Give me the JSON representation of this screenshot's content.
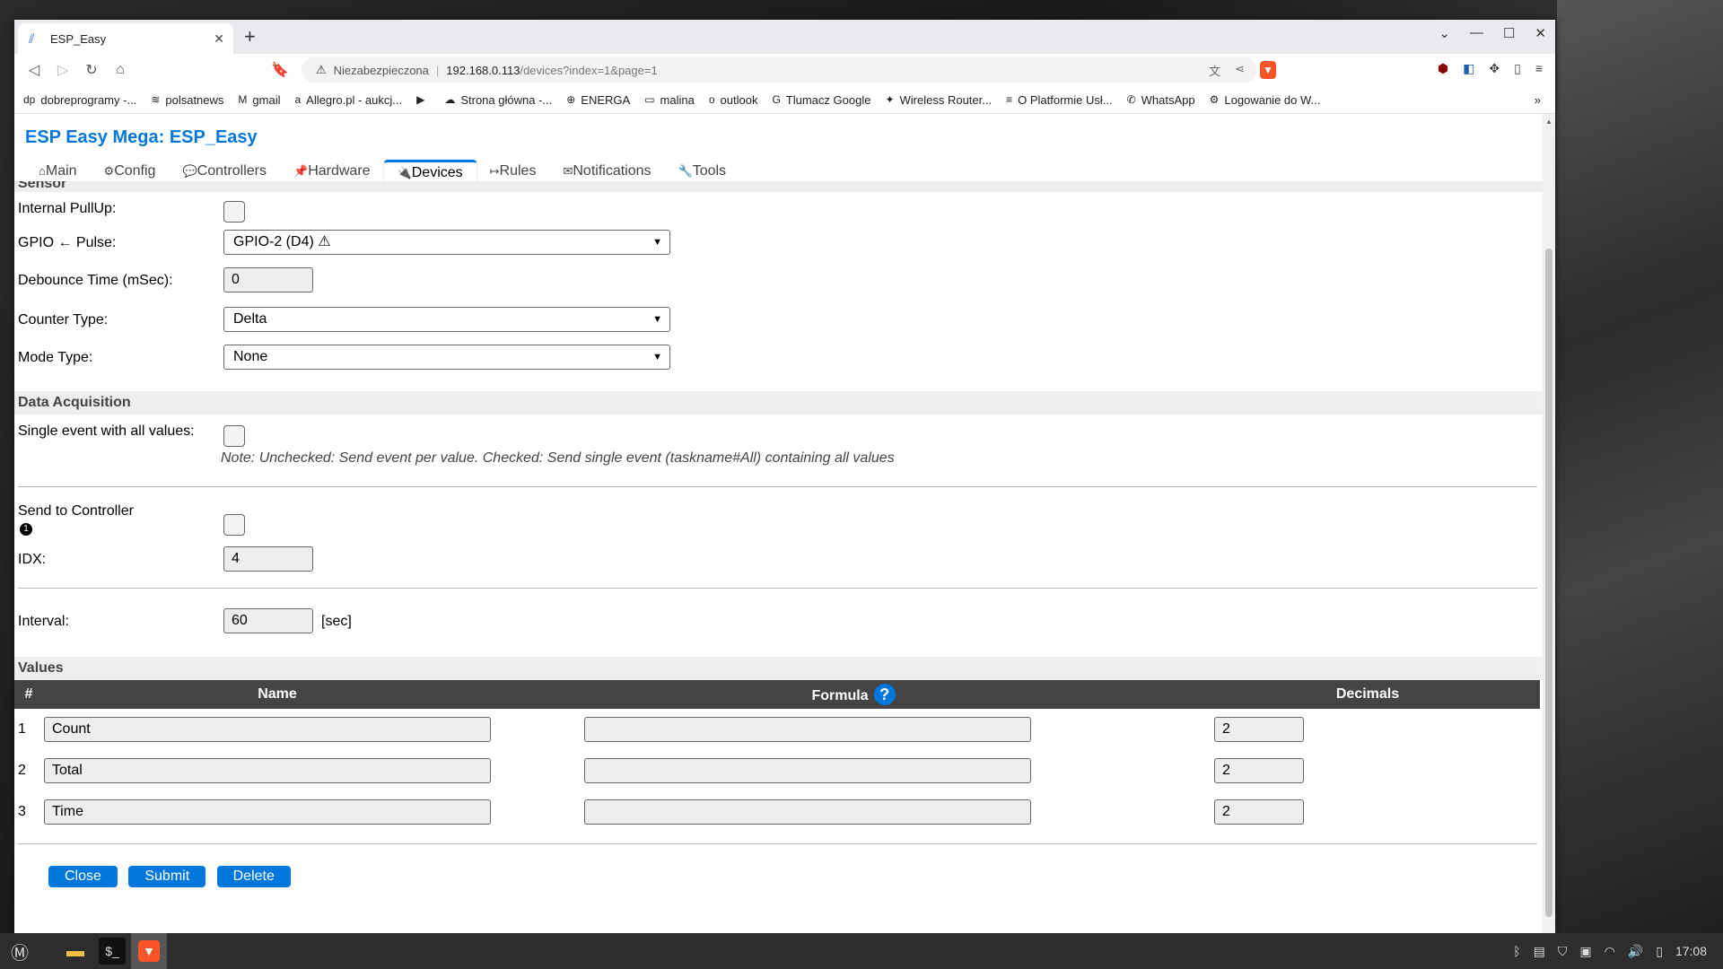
{
  "browser": {
    "tab_title": "ESP_Easy",
    "new_tab": "+",
    "url_warning": "Niezabezpieczona",
    "url_host": "192.168.0.113",
    "url_path": "/devices?index=1&page=1"
  },
  "bookmarks": [
    {
      "icon": "dp",
      "label": "dobreprogramy -..."
    },
    {
      "icon": "≋",
      "label": "polsatnews"
    },
    {
      "icon": "M",
      "label": "gmail"
    },
    {
      "icon": "a",
      "label": "Allegro.pl - aukcj..."
    },
    {
      "icon": "▶",
      "label": ""
    },
    {
      "icon": "☁",
      "label": "Strona główna -..."
    },
    {
      "icon": "⊕",
      "label": "ENERGA"
    },
    {
      "icon": "▭",
      "label": "malina"
    },
    {
      "icon": "o",
      "label": "outlook"
    },
    {
      "icon": "G",
      "label": "Tlumacz Google"
    },
    {
      "icon": "✦",
      "label": "Wireless Router..."
    },
    {
      "icon": "≡",
      "label": "O Platformie Usł..."
    },
    {
      "icon": "✆",
      "label": "WhatsApp"
    },
    {
      "icon": "⚙",
      "label": "Logowanie do W..."
    }
  ],
  "bookmarks_more": "»",
  "app": {
    "title": "ESP Easy Mega: ESP_Easy",
    "menu": [
      {
        "icon": "⌂",
        "label": "Main"
      },
      {
        "icon": "⚙",
        "label": "Config"
      },
      {
        "icon": "💬",
        "label": "Controllers"
      },
      {
        "icon": "📌",
        "label": "Hardware"
      },
      {
        "icon": "🔌",
        "label": "Devices"
      },
      {
        "icon": "↦",
        "label": "Rules"
      },
      {
        "icon": "✉",
        "label": "Notifications"
      },
      {
        "icon": "🔧",
        "label": "Tools"
      }
    ]
  },
  "sensor": {
    "header": "Sensor",
    "pullup_label": "Internal PullUp:",
    "gpio_label": "GPIO ← Pulse:",
    "gpio_value": "GPIO-2 (D4) ⚠",
    "debounce_label": "Debounce Time (mSec):",
    "debounce_value": "0",
    "counter_label": "Counter Type:",
    "counter_value": "Delta",
    "mode_label": "Mode Type:",
    "mode_value": "None"
  },
  "acq": {
    "header": "Data Acquisition",
    "single_label": "Single event with all values:",
    "note": "Note: Unchecked: Send event per value. Checked: Send single event (taskname#All) containing all values",
    "send_label": "Send to Controller",
    "send_num": "1",
    "idx_label": "IDX:",
    "idx_value": "4",
    "interval_label": "Interval:",
    "interval_value": "60",
    "interval_unit": "[sec]"
  },
  "values": {
    "header": "Values",
    "cols": {
      "num": "#",
      "name": "Name",
      "formula": "Formula",
      "help": "?",
      "decimals": "Decimals"
    },
    "rows": [
      {
        "num": "1",
        "name": "Count",
        "formula": "",
        "decimals": "2"
      },
      {
        "num": "2",
        "name": "Total",
        "formula": "",
        "decimals": "2"
      },
      {
        "num": "3",
        "name": "Time",
        "formula": "",
        "decimals": "2"
      }
    ]
  },
  "buttons": {
    "close": "Close",
    "submit": "Submit",
    "delete": "Delete"
  },
  "taskbar": {
    "time": "17:08"
  }
}
